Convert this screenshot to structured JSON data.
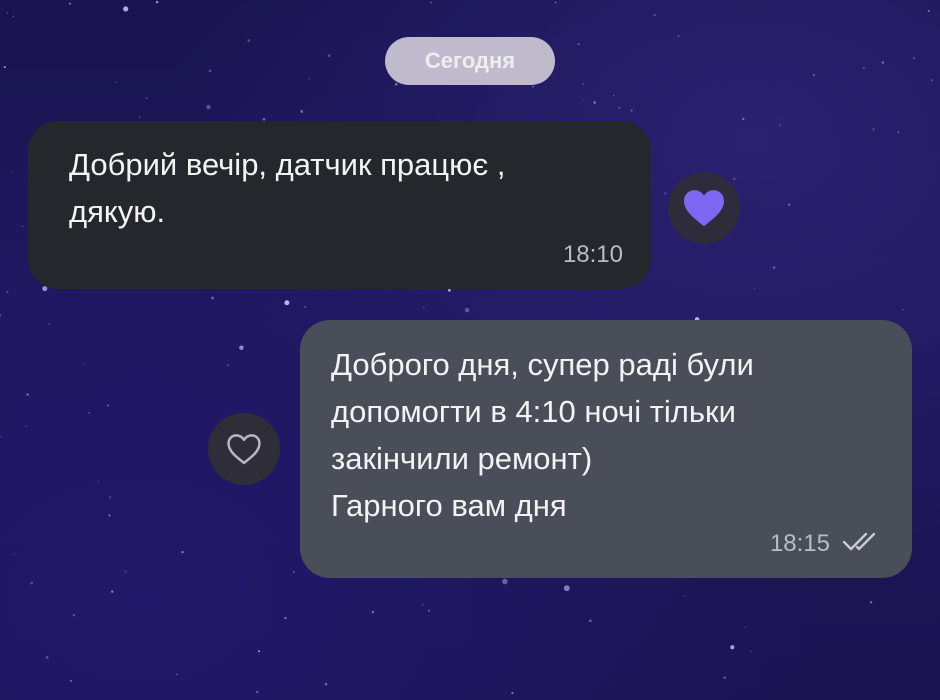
{
  "chat": {
    "date_separator": "Сегодня",
    "messages": [
      {
        "direction": "incoming",
        "text": "Добрий вечір, датчик працює ,\nдякую.",
        "time": "18:10",
        "reaction": "filled-heart"
      },
      {
        "direction": "outgoing",
        "text": "Доброго дня, супер раді були\nдопомогти в 4:10 ночі тільки\nзакінчили ремонт)\nГарного вам дня",
        "time": "18:15",
        "status_icon": "double-check-icon",
        "reaction": "outline-heart"
      }
    ]
  },
  "colors": {
    "background": "#1e175c",
    "incoming_bubble": "#26272c",
    "outgoing_bubble": "#4a4e58",
    "reaction_heart": "#7e67f2",
    "date_pill": "#cdc9d6"
  }
}
